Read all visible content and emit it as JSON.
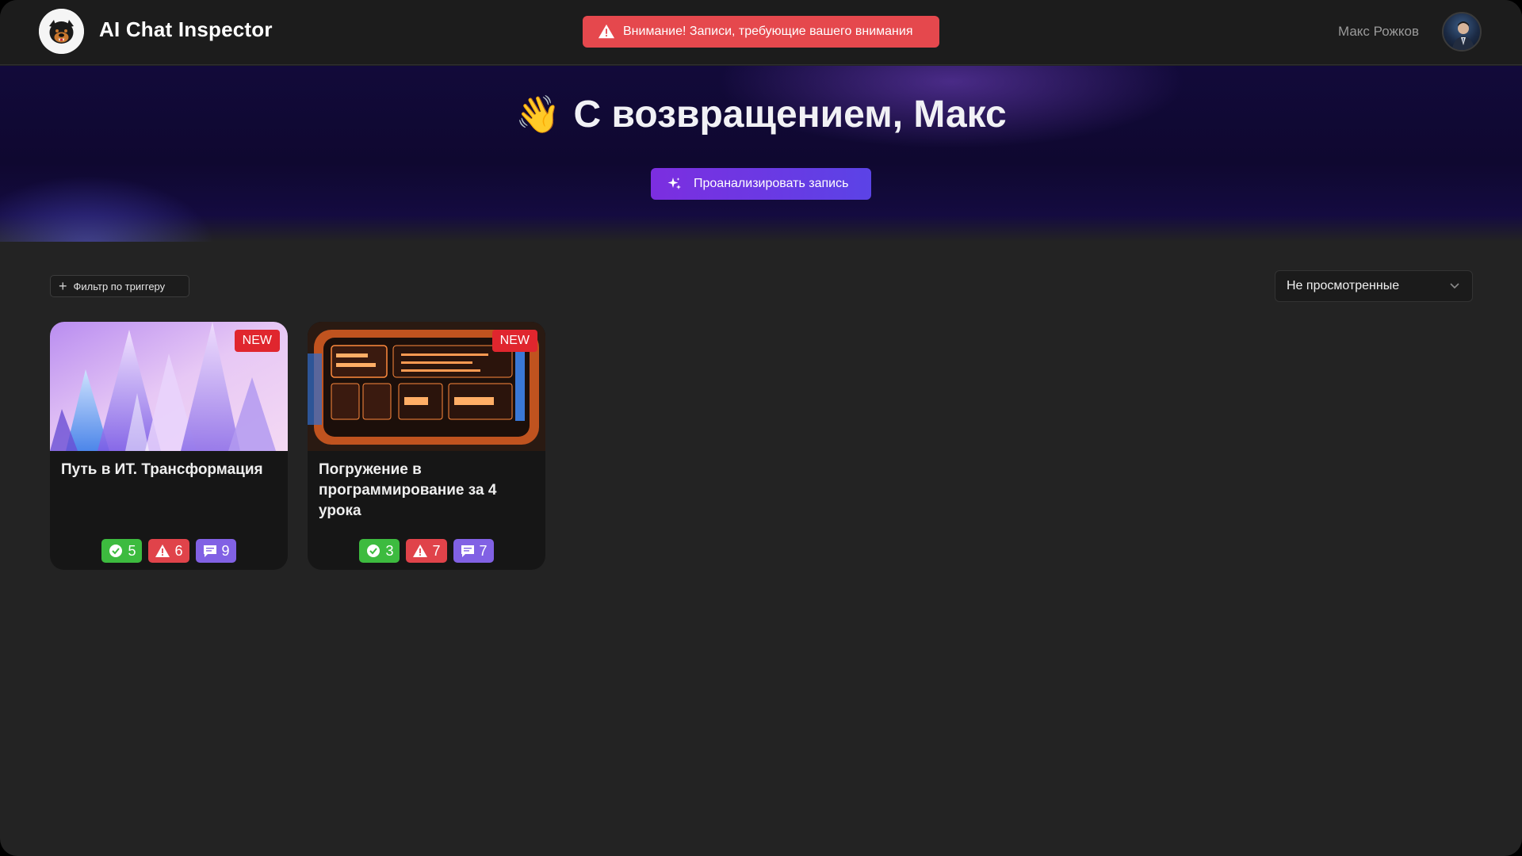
{
  "app": {
    "title": "AI Chat Inspector",
    "logo_icon": "rottweiler-logo-icon"
  },
  "header": {
    "alert_text": "Внимание! Записи, требующие вашего внимания",
    "alert_icon": "warning-icon",
    "user_name": "Макс Рожков"
  },
  "hero": {
    "greeting_emoji": "👋",
    "greeting": "С возвращением, Макс",
    "analyze_label": "Проанализировать запись",
    "analyze_icon": "sparkles-icon"
  },
  "filters": {
    "trigger_filter_label": "Фильтр по триггеру",
    "view_select_value": "Не просмотренные"
  },
  "cards": [
    {
      "title": "Путь в ИТ. Трансформация",
      "badge": "NEW",
      "ok": "5",
      "warnings": "6",
      "messages": "9",
      "thumb": "crystals-image"
    },
    {
      "title": "Погружение в программирование за 4 урока",
      "badge": "NEW",
      "ok": "3",
      "warnings": "7",
      "messages": "7",
      "thumb": "dashboard-image"
    }
  ],
  "colors": {
    "alert": "#e5484d",
    "accent_start": "#7c2ee0",
    "accent_end": "#5b43e6",
    "ok": "#3dbb3f",
    "warn": "#e0434a",
    "msg": "#8161e4",
    "new_badge": "#e0262e"
  }
}
